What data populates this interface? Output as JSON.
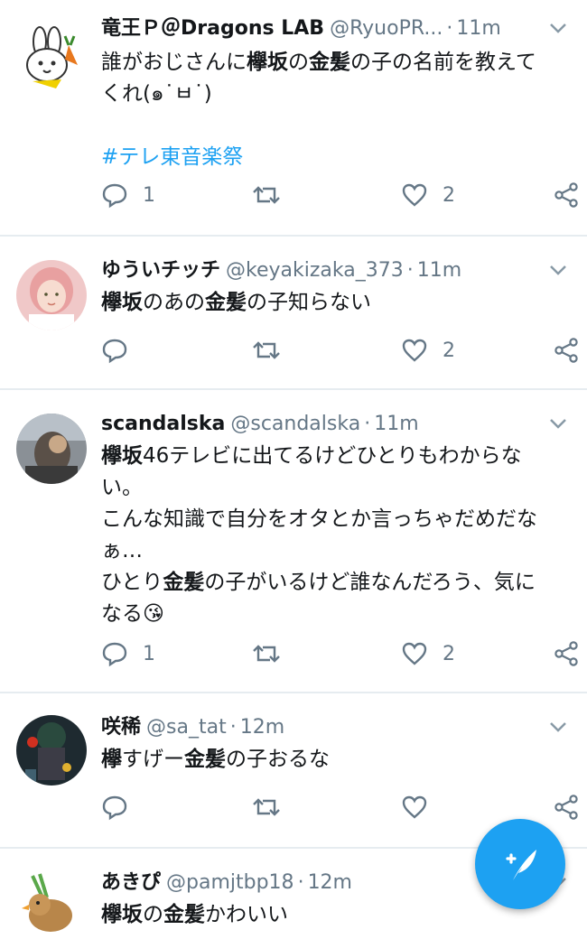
{
  "tweets": [
    {
      "name": "竜王Ｐ＠Dragons LAB",
      "handle": "@RyuoPR...",
      "time": "11m",
      "lines": [
        [
          {
            "t": "誰がおじさんに"
          },
          {
            "t": "欅坂",
            "b": true
          },
          {
            "t": "の"
          },
          {
            "t": "金髪",
            "b": true
          },
          {
            "t": "の子の名前を教えて"
          }
        ],
        [
          {
            "t": "くれ(๑˙ㅂ˙)"
          }
        ],
        [
          {
            "t": ""
          }
        ],
        [
          {
            "t": "#テレ東音楽祭",
            "h": true
          }
        ]
      ],
      "reply_count": "1",
      "like_count": "2",
      "avatar": "rabbit-avatar"
    },
    {
      "name": "ゆういチッチ",
      "handle": "@keyakizaka_373",
      "time": "11m",
      "lines": [
        [
          {
            "t": "欅坂",
            "b": true
          },
          {
            "t": "のあの"
          },
          {
            "t": "金髪",
            "b": true
          },
          {
            "t": "の子知らない"
          }
        ]
      ],
      "reply_count": "",
      "like_count": "2",
      "avatar": "girl-avatar"
    },
    {
      "name": "scandalska",
      "handle": "@scandalska",
      "time": "11m",
      "lines": [
        [
          {
            "t": "欅坂",
            "b": true
          },
          {
            "t": "46テレビに出てるけどひとりもわからな"
          }
        ],
        [
          {
            "t": "い。"
          }
        ],
        [
          {
            "t": "こんな知識で自分をオタとか言っちゃだめだな"
          }
        ],
        [
          {
            "t": "ぁ…"
          }
        ],
        [
          {
            "t": "ひとり"
          },
          {
            "t": "金髪",
            "b": true
          },
          {
            "t": "の子がいるけど誰なんだろう、気に"
          }
        ],
        [
          {
            "t": "なる😘"
          }
        ]
      ],
      "reply_count": "1",
      "like_count": "2",
      "avatar": "photo-avatar"
    },
    {
      "name": "咲稀",
      "handle": "@sa_tat",
      "time": "12m",
      "lines": [
        [
          {
            "t": "欅",
            "b": true
          },
          {
            "t": "すげー"
          },
          {
            "t": "金髪",
            "b": true
          },
          {
            "t": "の子おるな"
          }
        ]
      ],
      "reply_count": "",
      "like_count": "",
      "avatar": "game-avatar"
    },
    {
      "name": "あきぴ",
      "handle": "@pamjtbp18",
      "time": "12m",
      "lines": [
        [
          {
            "t": "欅坂",
            "b": true
          },
          {
            "t": "の"
          },
          {
            "t": "金髪",
            "b": true
          },
          {
            "t": "かわいい"
          }
        ]
      ],
      "reply_count": "",
      "like_count": "",
      "avatar": "duck-avatar"
    }
  ],
  "fab": {
    "icon": "compose-tweet-icon"
  },
  "colors": {
    "accent": "#1da1f2",
    "secondary_text": "#657786",
    "divider": "#e6ecf0"
  }
}
